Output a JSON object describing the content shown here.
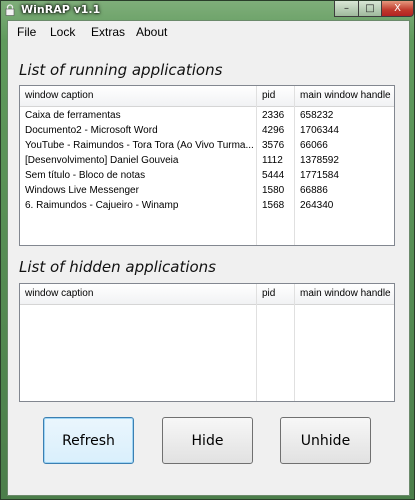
{
  "window": {
    "title": "WinRAP v1.1"
  },
  "menu": {
    "items": [
      "File",
      "Lock",
      "Extras",
      "About"
    ]
  },
  "running": {
    "title": "List of running applications",
    "columns": [
      "window caption",
      "pid",
      "main window handle"
    ],
    "rows": [
      [
        "Caixa de ferramentas",
        "2336",
        "658232"
      ],
      [
        "Documento2 - Microsoft Word",
        "4296",
        "1706344"
      ],
      [
        "YouTube - Raimundos - Tora Tora (Ao Vivo Turma...",
        "3576",
        "66066"
      ],
      [
        "[Desenvolvimento] Daniel Gouveia",
        "1112",
        "1378592"
      ],
      [
        "Sem título - Bloco de notas",
        "5444",
        "1771584"
      ],
      [
        "Windows Live Messenger",
        "1580",
        "66886"
      ],
      [
        "6. Raimundos - Cajueiro - Winamp",
        "1568",
        "264340"
      ]
    ]
  },
  "hidden": {
    "title": "List of hidden applications",
    "columns": [
      "window caption",
      "pid",
      "main window handle"
    ],
    "rows": []
  },
  "buttons": {
    "refresh": "Refresh",
    "hide": "Hide",
    "unhide": "Unhide"
  },
  "caption_buttons": {
    "minimize": "–",
    "maximize": "□",
    "close": "X"
  }
}
